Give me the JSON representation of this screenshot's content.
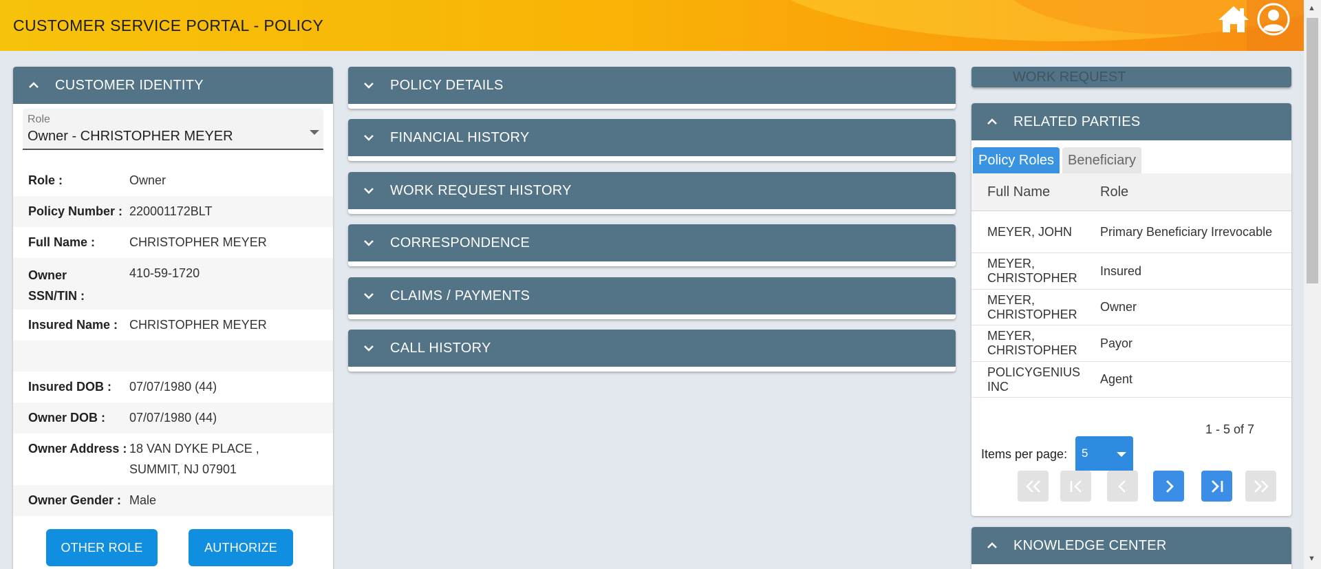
{
  "header": {
    "title": "CUSTOMER SERVICE PORTAL - POLICY",
    "home_icon": "home-icon",
    "user_icon": "user-circle-icon"
  },
  "customer_identity": {
    "title": "CUSTOMER IDENTITY",
    "role_select": {
      "label": "Role",
      "value": "Owner - CHRISTOPHER MEYER"
    },
    "fields": [
      {
        "label": "Role :",
        "value": "Owner"
      },
      {
        "label": "Policy Number :",
        "value": "220001172BLT"
      },
      {
        "label": "Full Name :",
        "value": "CHRISTOPHER MEYER"
      },
      {
        "label": "Owner SSN/TIN :",
        "value": "410-59-1720"
      },
      {
        "label": "Insured Name :",
        "value": "CHRISTOPHER MEYER"
      },
      {
        "label": "",
        "value": ""
      },
      {
        "label": "Insured DOB :",
        "value": "07/07/1980 (44)"
      },
      {
        "label": "Owner DOB :",
        "value": "07/07/1980 (44)"
      },
      {
        "label": "Owner Address :",
        "value": "18 VAN DYKE PLACE , SUMMIT, NJ 07901"
      },
      {
        "label": "Owner Gender :",
        "value": "Male"
      }
    ],
    "buttons": {
      "other_role": "OTHER ROLE",
      "authorize": "AUTHORIZE"
    }
  },
  "accordions": [
    {
      "title": "POLICY DETAILS"
    },
    {
      "title": "FINANCIAL HISTORY"
    },
    {
      "title": "WORK REQUEST HISTORY"
    },
    {
      "title": "CORRESPONDENCE"
    },
    {
      "title": "CLAIMS / PAYMENTS"
    },
    {
      "title": "CALL HISTORY"
    }
  ],
  "work_request": {
    "title": "WORK REQUEST"
  },
  "related_parties": {
    "title": "RELATED PARTIES",
    "tabs": [
      "Policy Roles",
      "Beneficiary"
    ],
    "columns": [
      "Full Name",
      "Role"
    ],
    "rows": [
      {
        "name": "MEYER, JOHN",
        "role": "Primary Beneficiary Irrevocable"
      },
      {
        "name": "MEYER, CHRISTOPHER",
        "role": "Insured"
      },
      {
        "name": "MEYER, CHRISTOPHER",
        "role": "Owner"
      },
      {
        "name": "MEYER, CHRISTOPHER",
        "role": "Payor"
      },
      {
        "name": "POLICYGENIUS INC",
        "role": "Agent"
      }
    ],
    "paginator": {
      "range": "1 - 5 of 7",
      "items_per_page_label": "Items per page:",
      "items_per_page_value": "5",
      "buttons": [
        "first-page-icon",
        "first-icon",
        "previous-icon",
        "next-icon",
        "last-icon",
        "last-page-icon"
      ]
    }
  },
  "knowledge_center": {
    "title": "KNOWLEDGE CENTER"
  },
  "colors": {
    "panel_header": "#537387",
    "primary_button": "#108ee0",
    "header_gradient_start": "#f7c20a",
    "header_gradient_end": "#f98c12"
  }
}
